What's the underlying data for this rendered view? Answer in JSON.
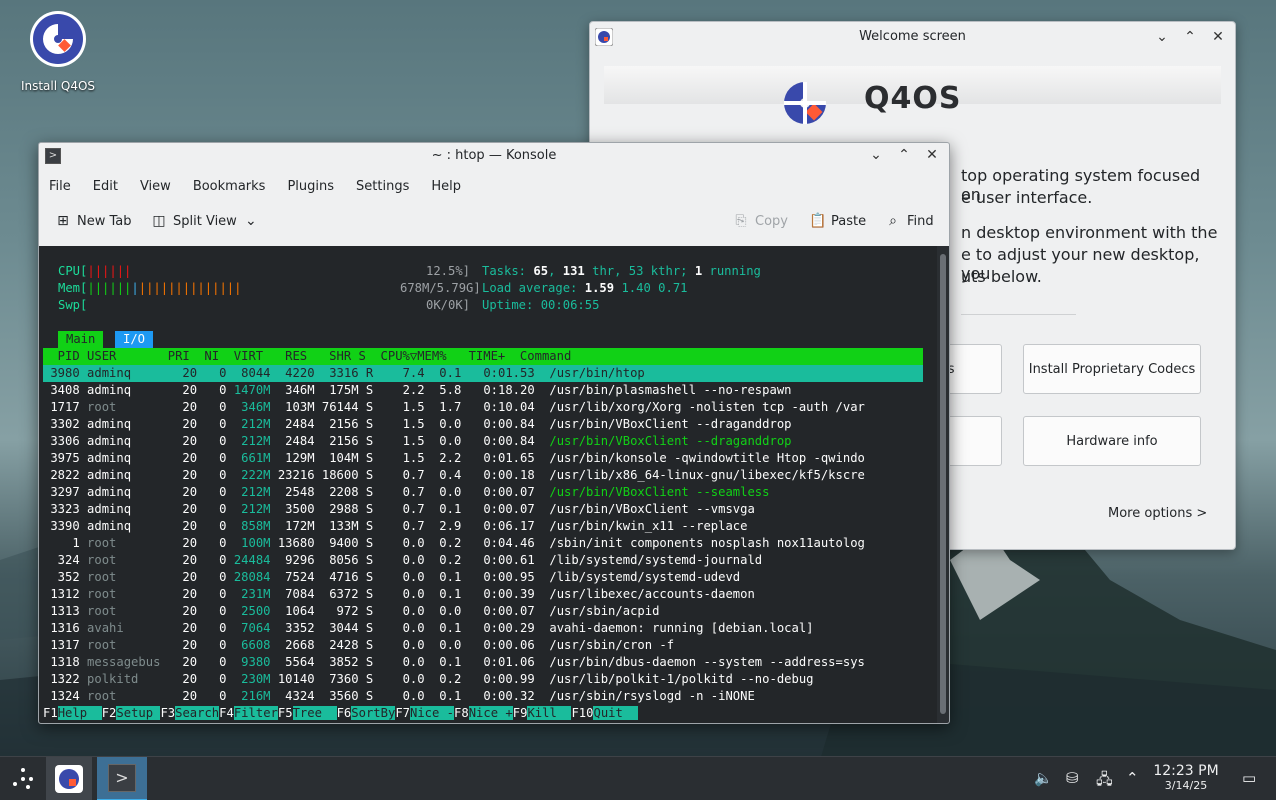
{
  "desktop": {
    "icon_label": "Install Q4OS"
  },
  "welcome": {
    "title": "Welcome screen",
    "brand": "Q4OS",
    "line1": "top operating system focused on",
    "line2": "e user interface.",
    "line3": "n desktop environment with the",
    "line4": "e to adjust your new desktop, you",
    "line5": "uts below.",
    "btn_left1": "ons",
    "btn_right1": "Install Proprietary Codecs",
    "btn_left2": "n",
    "btn_right2": "Hardware info",
    "more": "More options  >"
  },
  "konsole": {
    "title": "~ : htop — Konsole",
    "menu": [
      "File",
      "Edit",
      "View",
      "Bookmarks",
      "Plugins",
      "Settings",
      "Help"
    ],
    "toolbar": {
      "new_tab": "New Tab",
      "split_view": "Split View",
      "copy": "Copy",
      "paste": "Paste",
      "find": "Find"
    }
  },
  "htop": {
    "cpu_label": "CPU[",
    "cpu_bars": "||||||",
    "cpu_pct": "12.5%]",
    "mem_label": "Mem[",
    "mem_bars_g": "||||||",
    "mem_bars_b": "|",
    "mem_bars_o": "||||||||||||||",
    "mem_val": "678M/5.79G]",
    "swp_label": "Swp[",
    "swp_val": "0K/0K]",
    "tasks_label": "Tasks:",
    "tasks": "65",
    "thr": "131",
    "kthr": "53",
    "running": "1",
    "tasks_text": " thr, 53 kthr; ",
    "running_text": " running",
    "load_label": "Load average:",
    "load1": "1.59",
    "load5": "1.40",
    "load15": "0.71",
    "uptime_label": "Uptime:",
    "uptime": "00:06:55",
    "tab_main": "Main",
    "tab_io": "I/O",
    "header": "  PID USER       PRI  NI  VIRT   RES   SHR S  CPU%▽MEM%   TIME+  Command",
    "rows": [
      [
        "3980",
        "adminq",
        "20",
        "0",
        "8044",
        "4220",
        "3316",
        "R",
        "7.4",
        "0.1",
        "0:01.53",
        "/usr/bin/htop"
      ],
      [
        "3408",
        "adminq",
        "20",
        "0",
        "1470M",
        "346M",
        "175M",
        "S",
        "2.2",
        "5.8",
        "0:18.20",
        "/usr/bin/plasmashell --no-respawn"
      ],
      [
        "1717",
        "root",
        "20",
        "0",
        "346M",
        "103M",
        "76144",
        "S",
        "1.5",
        "1.7",
        "0:10.04",
        "/usr/lib/xorg/Xorg -nolisten tcp -auth /var"
      ],
      [
        "3302",
        "adminq",
        "20",
        "0",
        "212M",
        "2484",
        "2156",
        "S",
        "1.5",
        "0.0",
        "0:00.84",
        "/usr/bin/VBoxClient --draganddrop"
      ],
      [
        "3306",
        "adminq",
        "20",
        "0",
        "212M",
        "2484",
        "2156",
        "S",
        "1.5",
        "0.0",
        "0:00.84",
        "/usr/bin/VBoxClient --draganddrop"
      ],
      [
        "3975",
        "adminq",
        "20",
        "0",
        "661M",
        "129M",
        "104M",
        "S",
        "1.5",
        "2.2",
        "0:01.65",
        "/usr/bin/konsole -qwindowtitle Htop -qwindo"
      ],
      [
        "2822",
        "adminq",
        "20",
        "0",
        "222M",
        "23216",
        "18600",
        "S",
        "0.7",
        "0.4",
        "0:00.18",
        "/usr/lib/x86_64-linux-gnu/libexec/kf5/kscre"
      ],
      [
        "3297",
        "adminq",
        "20",
        "0",
        "212M",
        "2548",
        "2208",
        "S",
        "0.7",
        "0.0",
        "0:00.07",
        "/usr/bin/VBoxClient --seamless"
      ],
      [
        "3323",
        "adminq",
        "20",
        "0",
        "212M",
        "3500",
        "2988",
        "S",
        "0.7",
        "0.1",
        "0:00.07",
        "/usr/bin/VBoxClient --vmsvga"
      ],
      [
        "3390",
        "adminq",
        "20",
        "0",
        "858M",
        "172M",
        "133M",
        "S",
        "0.7",
        "2.9",
        "0:06.17",
        "/usr/bin/kwin_x11 --replace"
      ],
      [
        "1",
        "root",
        "20",
        "0",
        "100M",
        "13680",
        "9400",
        "S",
        "0.0",
        "0.2",
        "0:04.46",
        "/sbin/init components nosplash nox11autolog"
      ],
      [
        "324",
        "root",
        "20",
        "0",
        "24484",
        "9296",
        "8056",
        "S",
        "0.0",
        "0.2",
        "0:00.61",
        "/lib/systemd/systemd-journald"
      ],
      [
        "352",
        "root",
        "20",
        "0",
        "28084",
        "7524",
        "4716",
        "S",
        "0.0",
        "0.1",
        "0:00.95",
        "/lib/systemd/systemd-udevd"
      ],
      [
        "1312",
        "root",
        "20",
        "0",
        "231M",
        "7084",
        "6372",
        "S",
        "0.0",
        "0.1",
        "0:00.39",
        "/usr/libexec/accounts-daemon"
      ],
      [
        "1313",
        "root",
        "20",
        "0",
        "2500",
        "1064",
        "972",
        "S",
        "0.0",
        "0.0",
        "0:00.07",
        "/usr/sbin/acpid"
      ],
      [
        "1316",
        "avahi",
        "20",
        "0",
        "7064",
        "3352",
        "3044",
        "S",
        "0.0",
        "0.1",
        "0:00.29",
        "avahi-daemon: running [debian.local]"
      ],
      [
        "1317",
        "root",
        "20",
        "0",
        "6608",
        "2668",
        "2428",
        "S",
        "0.0",
        "0.0",
        "0:00.06",
        "/usr/sbin/cron -f"
      ],
      [
        "1318",
        "messagebus",
        "20",
        "0",
        "9380",
        "5564",
        "3852",
        "S",
        "0.0",
        "0.1",
        "0:01.06",
        "/usr/bin/dbus-daemon --system --address=sys"
      ],
      [
        "1322",
        "polkitd",
        "20",
        "0",
        "230M",
        "10140",
        "7360",
        "S",
        "0.0",
        "0.2",
        "0:00.99",
        "/usr/lib/polkit-1/polkitd --no-debug"
      ],
      [
        "1324",
        "root",
        "20",
        "0",
        "216M",
        "4324",
        "3560",
        "S",
        "0.0",
        "0.1",
        "0:00.32",
        "/usr/sbin/rsyslogd -n -iNONE"
      ]
    ],
    "fkeys": [
      [
        "F1",
        "Help"
      ],
      [
        "F2",
        "Setup"
      ],
      [
        "F3",
        "Search"
      ],
      [
        "F4",
        "Filter"
      ],
      [
        "F5",
        "Tree"
      ],
      [
        "F6",
        "SortBy"
      ],
      [
        "F7",
        "Nice -"
      ],
      [
        "F8",
        "Nice +"
      ],
      [
        "F9",
        "Kill"
      ],
      [
        "F10",
        "Quit"
      ]
    ]
  },
  "taskbar": {
    "time": "12:23 PM",
    "date": "3/14/25"
  }
}
